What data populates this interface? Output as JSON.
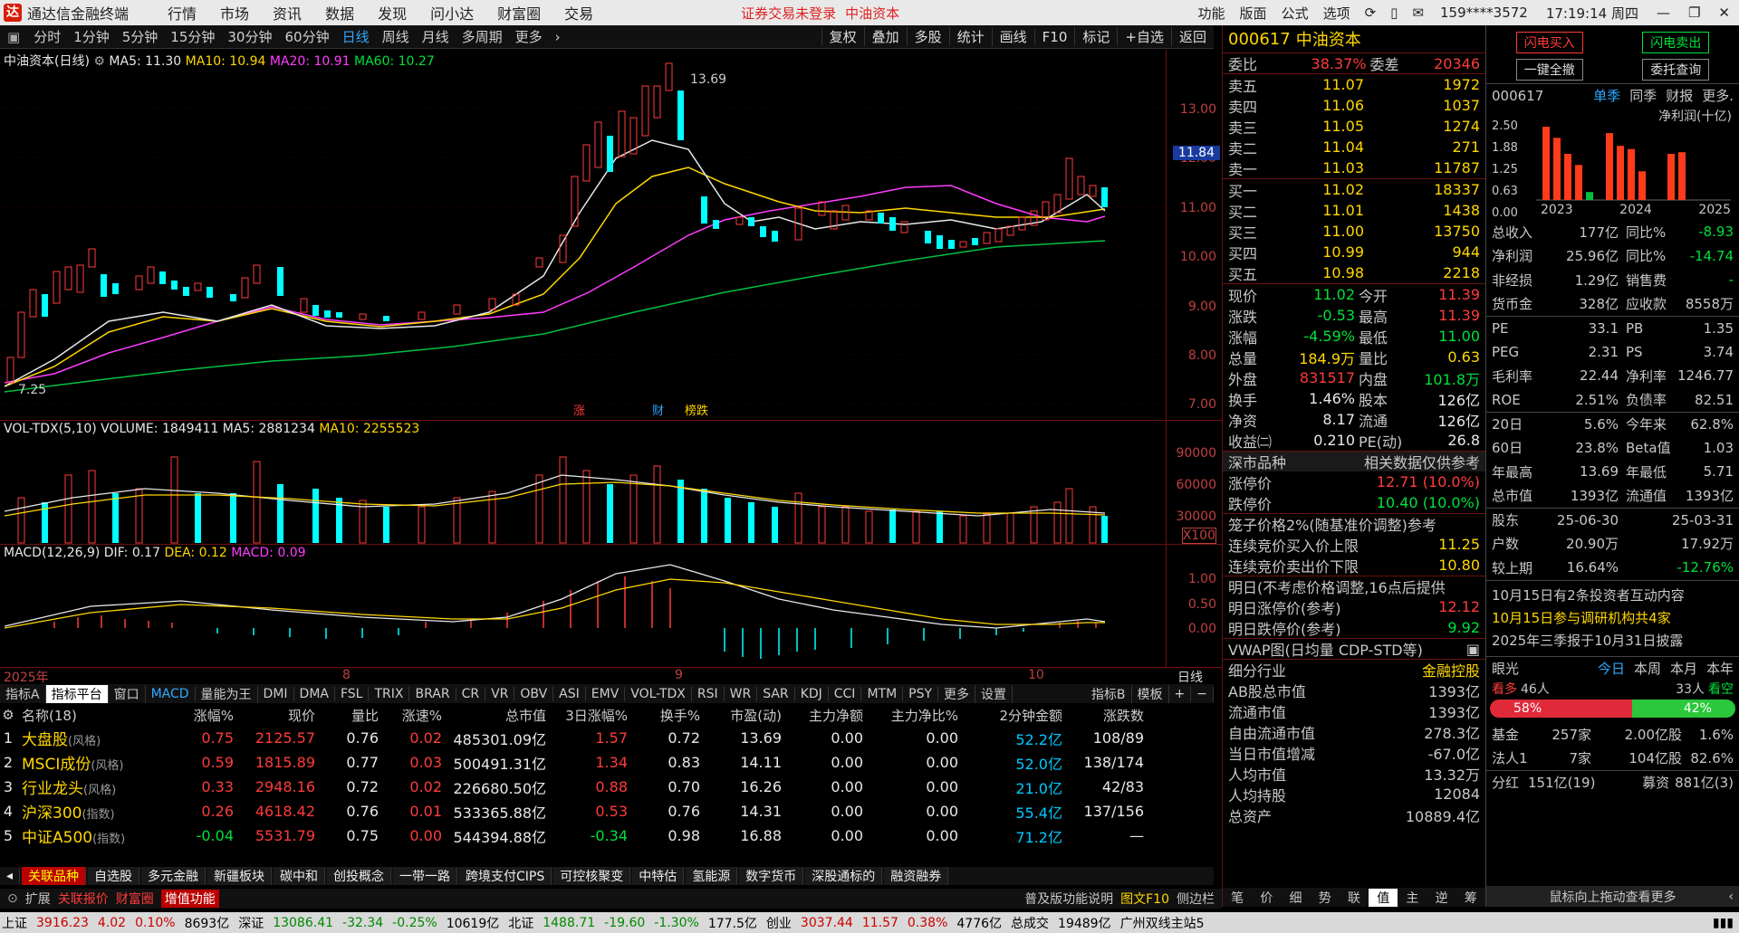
{
  "app_title": "通达信金融终端",
  "top_menu": [
    "行情",
    "市场",
    "资讯",
    "数据",
    "发现",
    "问小达",
    "财富圈",
    "交易"
  ],
  "top_notice": "证券交易未登录",
  "top_stock": "中油资本",
  "top_right_menu": [
    "功能",
    "版面",
    "公式",
    "选项"
  ],
  "user_id": "159****3572",
  "clock": "17:19:14 周四",
  "periods": [
    "分时",
    "1分钟",
    "5分钟",
    "15分钟",
    "30分钟",
    "60分钟",
    "日线",
    "周线",
    "月线",
    "多周期",
    "更多"
  ],
  "active_period": "日线",
  "chart_tools": [
    "复权",
    "叠加",
    "多股",
    "统计",
    "画线",
    "F10",
    "标记",
    "+自选",
    "返回"
  ],
  "main_legend": {
    "name": "中油资本(日线)",
    "ma5": "MA5: 11.30",
    "ma10": "MA10: 10.94",
    "ma20": "MA20: 10.91",
    "ma60": "MA60: 10.27"
  },
  "price_axis": [
    "13.00",
    "12.00",
    "11.00",
    "10.00",
    "9.00",
    "8.00",
    "7.00"
  ],
  "current_price_tag": "11.84",
  "high_label": "13.69",
  "low_label": "7.25",
  "chart_markers": [
    "涨",
    "财",
    "榜跌"
  ],
  "vol_legend": {
    "name": "VOL-TDX(5,10)",
    "volume": "VOLUME: 1849411",
    "ma5": "MA5: 2881234",
    "ma10": "MA10: 2255523"
  },
  "vol_axis": [
    "90000",
    "60000",
    "30000"
  ],
  "vol_unit": "X100",
  "macd_legend": {
    "name": "MACD(12,26,9)",
    "dif": "DIF: 0.17",
    "dea": "DEA: 0.12",
    "macd": "MACD: 0.09"
  },
  "macd_axis": [
    "1.00",
    "0.50",
    "0.00"
  ],
  "time_axis": [
    "2025年",
    "8",
    "9",
    "10"
  ],
  "time_axis_right": "日线",
  "indicator_tabs": [
    "指标A",
    "指标平台",
    "窗口",
    "MACD",
    "量能为王",
    "DMI",
    "DMA",
    "FSL",
    "TRIX",
    "BRAR",
    "CR",
    "VR",
    "OBV",
    "ASI",
    "EMV",
    "VOL-TDX",
    "RSI",
    "WR",
    "SAR",
    "KDJ",
    "CCI",
    "MTM",
    "PSY",
    "更多",
    "设置"
  ],
  "indicator_right": [
    "指标B",
    "模板",
    "+",
    "−"
  ],
  "table": {
    "headers": [
      "名称(18)",
      "涨幅%",
      "现价",
      "量比",
      "涨速%",
      "总市值",
      "3日涨幅%",
      "换手%",
      "市盈(动)",
      "主力净额",
      "主力净比%",
      "2分钟金额",
      "涨跌数"
    ],
    "rows": [
      {
        "idx": "1",
        "name": "大盘股",
        "tag": "(风格)",
        "chg": "0.75",
        "price": "2125.57",
        "lb": "0.76",
        "zs": "0.02",
        "mv": "485301.09亿",
        "c3": "1.57",
        "hs": "0.72",
        "pe": "13.69",
        "je": "0.00",
        "jb": "0.00",
        "amt": "52.2亿",
        "ud": "108/89"
      },
      {
        "idx": "2",
        "name": "MSCI成份",
        "tag": "(风格)",
        "chg": "0.59",
        "price": "1815.89",
        "lb": "0.77",
        "zs": "0.03",
        "mv": "500491.31亿",
        "c3": "1.34",
        "hs": "0.83",
        "pe": "14.11",
        "je": "0.00",
        "jb": "0.00",
        "amt": "52.0亿",
        "ud": "138/174"
      },
      {
        "idx": "3",
        "name": "行业龙头",
        "tag": "(风格)",
        "chg": "0.33",
        "price": "2948.16",
        "lb": "0.72",
        "zs": "0.02",
        "mv": "226680.50亿",
        "c3": "0.88",
        "hs": "0.70",
        "pe": "16.26",
        "je": "0.00",
        "jb": "0.00",
        "amt": "21.0亿",
        "ud": "42/83"
      },
      {
        "idx": "4",
        "name": "沪深300",
        "tag": "(指数)",
        "chg": "0.26",
        "price": "4618.42",
        "lb": "0.76",
        "zs": "0.01",
        "mv": "533365.88亿",
        "c3": "0.53",
        "hs": "0.76",
        "pe": "14.31",
        "je": "0.00",
        "jb": "0.00",
        "amt": "55.4亿",
        "ud": "137/156"
      },
      {
        "idx": "5",
        "name": "中证A500",
        "tag": "(指数)",
        "chg": "-0.04",
        "price": "5531.79",
        "lb": "0.75",
        "zs": "0.00",
        "mv": "544394.88亿",
        "c3": "-0.34",
        "hs": "0.98",
        "pe": "16.88",
        "je": "0.00",
        "jb": "0.00",
        "amt": "71.2亿",
        "ud": "—"
      }
    ]
  },
  "sector_tabs": [
    "关联品种",
    "自选股",
    "多元金融",
    "新疆板块",
    "碳中和",
    "创投概念",
    "一带一路",
    "跨境支付CIPS",
    "可控核聚变",
    "中特估",
    "氢能源",
    "数字货币",
    "深股通标的",
    "融资融券"
  ],
  "bottom_tabs": [
    "扩展",
    "关联报价",
    "财富圈",
    "增值功能"
  ],
  "bottom_right": [
    "普及版功能说明",
    "图文F10",
    "侧边栏"
  ],
  "quote": {
    "code": "000617",
    "name": "中油资本",
    "weibi_label": "委比",
    "weibi": "38.37%",
    "weicha_label": "委差",
    "weicha": "20346",
    "asks": [
      {
        "l": "卖五",
        "p": "11.07",
        "v": "1972"
      },
      {
        "l": "卖四",
        "p": "11.06",
        "v": "1037"
      },
      {
        "l": "卖三",
        "p": "11.05",
        "v": "1274"
      },
      {
        "l": "卖二",
        "p": "11.04",
        "v": "271"
      },
      {
        "l": "卖一",
        "p": "11.03",
        "v": "11787"
      }
    ],
    "bids": [
      {
        "l": "买一",
        "p": "11.02",
        "v": "18337"
      },
      {
        "l": "买二",
        "p": "11.01",
        "v": "1438"
      },
      {
        "l": "买三",
        "p": "11.00",
        "v": "13750"
      },
      {
        "l": "买四",
        "p": "10.99",
        "v": "944"
      },
      {
        "l": "买五",
        "p": "10.98",
        "v": "2218"
      }
    ],
    "stats": [
      {
        "a": "现价",
        "av": "11.02",
        "b": "今开",
        "bv": "11.39",
        "ac": "green",
        "bc": "red"
      },
      {
        "a": "涨跌",
        "av": "-0.53",
        "b": "最高",
        "bv": "11.39",
        "ac": "green",
        "bc": "red"
      },
      {
        "a": "涨幅",
        "av": "-4.59%",
        "b": "最低",
        "bv": "11.00",
        "ac": "green",
        "bc": "green"
      },
      {
        "a": "总量",
        "av": "184.9万",
        "b": "量比",
        "bv": "0.63",
        "ac": "yel",
        "bc": "yel"
      },
      {
        "a": "外盘",
        "av": "831517",
        "b": "内盘",
        "bv": "101.8万",
        "ac": "red",
        "bc": "green"
      },
      {
        "a": "换手",
        "av": "1.46%",
        "b": "股本",
        "bv": "126亿",
        "ac": "wht",
        "bc": "wht"
      },
      {
        "a": "净资",
        "av": "8.17",
        "b": "流通",
        "bv": "126亿",
        "ac": "wht",
        "bc": "wht"
      },
      {
        "a": "收益㈡",
        "av": "0.210",
        "b": "PE(动)",
        "bv": "26.8",
        "ac": "wht",
        "bc": "wht"
      }
    ],
    "market_label": "深市品种",
    "market_note": "相关数据仅供参考",
    "limit_up_label": "涨停价",
    "limit_up": "12.71 (10.0%)",
    "limit_down_label": "跌停价",
    "limit_down": "10.40 (10.0%)",
    "cage_title": "笼子价格2%(随基准价调整)参考",
    "cage_buy_label": "连续竞价买入价上限",
    "cage_buy": "11.25",
    "cage_sell_label": "连续竞价卖出价下限",
    "cage_sell": "10.80",
    "tomorrow_title": "明日(不考虑价格调整,16点后提供",
    "tomorrow_up_label": "明日涨停价(参考)",
    "tomorrow_up": "12.12",
    "tomorrow_down_label": "明日跌停价(参考)",
    "tomorrow_down": "9.92",
    "vwap": "VWAP图(日均量 CDP-STD等)",
    "industry_label": "细分行业",
    "industry": "金融控股",
    "facts": [
      {
        "l": "AB股总市值",
        "v": "1393亿"
      },
      {
        "l": "流通市值",
        "v": "1393亿"
      },
      {
        "l": "自由流通市值",
        "v": "278.3亿"
      },
      {
        "l": "当日市值增减",
        "v": "-67.0亿"
      },
      {
        "l": "人均市值",
        "v": "13.32万"
      },
      {
        "l": "人均持股",
        "v": "12084"
      },
      {
        "l": "总资产",
        "v": "10889.4亿"
      }
    ],
    "bottom_tabs": [
      "笔",
      "价",
      "细",
      "势",
      "联",
      "值",
      "主",
      "逆",
      "筹"
    ]
  },
  "f10": {
    "btn_flash_buy": "闪电买入",
    "btn_flash_sell": "闪电卖出",
    "btn_cancel_all": "一键全撤",
    "btn_query": "委托查询",
    "code": "000617",
    "tabs": [
      "单季",
      "同季",
      "财报",
      "更多."
    ],
    "chart_title": "净利润(十亿)",
    "chart_axis": [
      "2.50",
      "1.88",
      "1.25",
      "0.63",
      "0.00"
    ],
    "chart_years": [
      "2023",
      "2024",
      "2025"
    ],
    "chart_data": {
      "type": "bar",
      "title": "净利润(十亿)",
      "ylim": [
        0,
        2.5
      ],
      "categories": [
        "2023",
        "2024",
        "2025"
      ],
      "series": [
        {
          "values": [
            2.3,
            1.95,
            1.45,
            1.1,
            0.25
          ]
        },
        {
          "values": [
            2.1,
            1.7,
            1.6,
            0.9
          ]
        },
        {
          "values": [
            1.45,
            1.5
          ]
        }
      ]
    },
    "metrics": [
      {
        "a": "总收入",
        "av": "177亿",
        "b": "同比%",
        "bv": "-8.93"
      },
      {
        "a": "净利润",
        "av": "25.96亿",
        "b": "同比%",
        "bv": "-14.74"
      },
      {
        "a": "非经损",
        "av": "1.29亿",
        "b": "销售费",
        "bv": "-"
      },
      {
        "a": "货币金",
        "av": "328亿",
        "b": "应收款",
        "bv": "8558万"
      },
      {
        "a": "PE",
        "av": "33.1",
        "b": "PB",
        "bv": "1.35"
      },
      {
        "a": "PEG",
        "av": "2.31",
        "b": "PS",
        "bv": "3.74"
      },
      {
        "a": "毛利率",
        "av": "22.44",
        "b": "净利率",
        "bv": "1246.77"
      },
      {
        "a": "ROE",
        "av": "2.51%",
        "b": "负债率",
        "bv": "82.51"
      },
      {
        "a": "20日",
        "av": "5.6%",
        "b": "今年来",
        "bv": "62.8%"
      },
      {
        "a": "60日",
        "av": "23.8%",
        "b": "Beta值",
        "bv": "1.03"
      },
      {
        "a": "年最高",
        "av": "13.69",
        "b": "年最低",
        "bv": "5.71"
      },
      {
        "a": "总市值",
        "av": "1393亿",
        "b": "流通值",
        "bv": "1393亿"
      },
      {
        "a": "股东",
        "av": "25-06-30",
        "b": "",
        "bv": "25-03-31"
      },
      {
        "a": "户数",
        "av": "20.90万",
        "b": "",
        "bv": "17.92万"
      },
      {
        "a": "较上期",
        "av": "16.64%",
        "b": "",
        "bv": "-12.76%"
      }
    ],
    "news1": "10月15日有2条投资者互动内容",
    "news2": "10月15日参与调研机构共4家",
    "news3": "2025年三季报于10月31日披露",
    "sentiment_title": "眼光",
    "sentiment_tabs": [
      "今日",
      "本周",
      "本月",
      "本年"
    ],
    "bull_label": "看多",
    "bull_count": "46人",
    "bear_count": "33人",
    "bear_label": "看空",
    "bull_pct": "58%",
    "bear_pct": "42%",
    "holders": [
      {
        "l": "基金",
        "n": "257家",
        "s": "2.00亿股",
        "p": "1.6%"
      },
      {
        "l": "法人1",
        "n": "7家",
        "s": "104亿股",
        "p": "82.6%"
      }
    ],
    "dividend_label": "分红",
    "dividend": "151亿(19)",
    "raise_label": "募资",
    "raise": "881亿(3)",
    "drag_hint": "鼠标向上拖动查看更多"
  },
  "status": {
    "sh_label": "上证",
    "sh": "3916.23",
    "sh_chg": "4.02",
    "sh_pct": "0.10%",
    "sh_amt": "8693亿",
    "sz_label": "深证",
    "sz": "13086.41",
    "sz_chg": "-32.34",
    "sz_pct": "-0.25%",
    "sz_amt": "10619亿",
    "bz_label": "北证",
    "bz": "1488.71",
    "bz_chg": "-19.60",
    "bz_pct": "-1.30%",
    "bz_amt": "177.5亿",
    "cy_label": "创业",
    "cy": "3037.44",
    "cy_chg": "11.57",
    "cy_pct": "0.38%",
    "cy_amt": "4776亿",
    "total_label": "总成交",
    "total": "19489亿",
    "server": "广州双线主站5"
  }
}
